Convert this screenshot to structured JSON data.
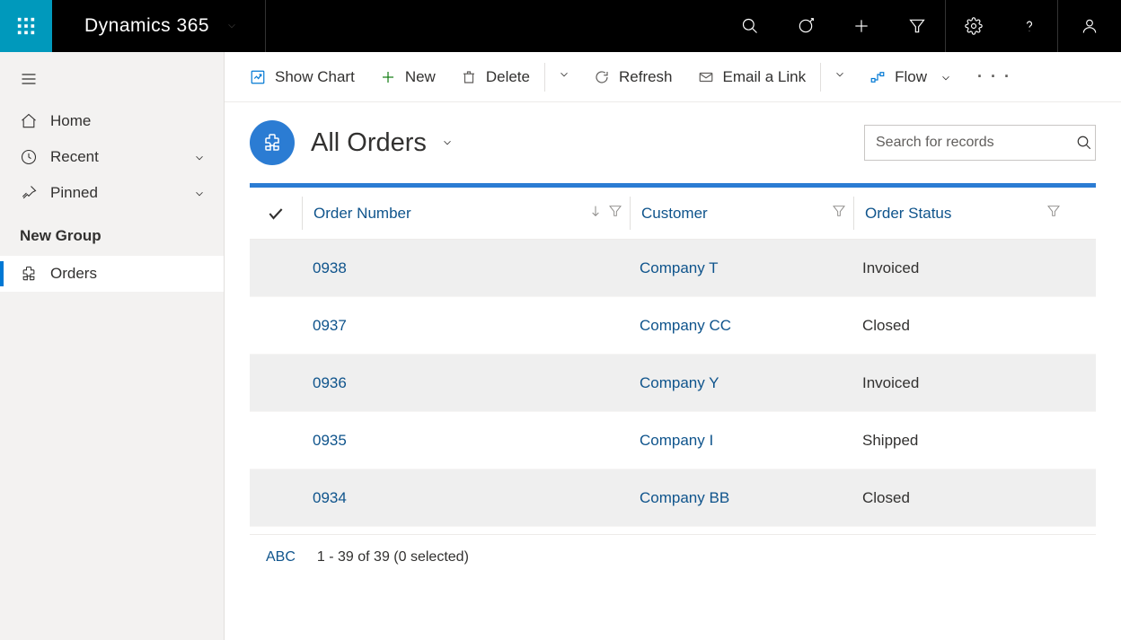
{
  "topbar": {
    "brand": "Dynamics 365"
  },
  "sidebar": {
    "items": [
      {
        "label": "Home"
      },
      {
        "label": "Recent"
      },
      {
        "label": "Pinned"
      }
    ],
    "group_header": "New Group",
    "group_items": [
      {
        "label": "Orders"
      }
    ]
  },
  "commands": {
    "show_chart": "Show Chart",
    "new": "New",
    "delete": "Delete",
    "refresh": "Refresh",
    "email_link": "Email a Link",
    "flow": "Flow"
  },
  "view": {
    "title": "All Orders",
    "search_placeholder": "Search for records"
  },
  "grid": {
    "columns": {
      "order_number": "Order Number",
      "customer": "Customer",
      "order_status": "Order Status"
    },
    "rows": [
      {
        "order": "0938",
        "customer": "Company T",
        "status": "Invoiced"
      },
      {
        "order": "0937",
        "customer": "Company CC",
        "status": "Closed"
      },
      {
        "order": "0936",
        "customer": "Company Y",
        "status": "Invoiced"
      },
      {
        "order": "0935",
        "customer": "Company I",
        "status": "Shipped"
      },
      {
        "order": "0934",
        "customer": "Company BB",
        "status": "Closed"
      }
    ],
    "footer": {
      "abc": "ABC",
      "count": "1 - 39 of 39 (0 selected)"
    }
  }
}
